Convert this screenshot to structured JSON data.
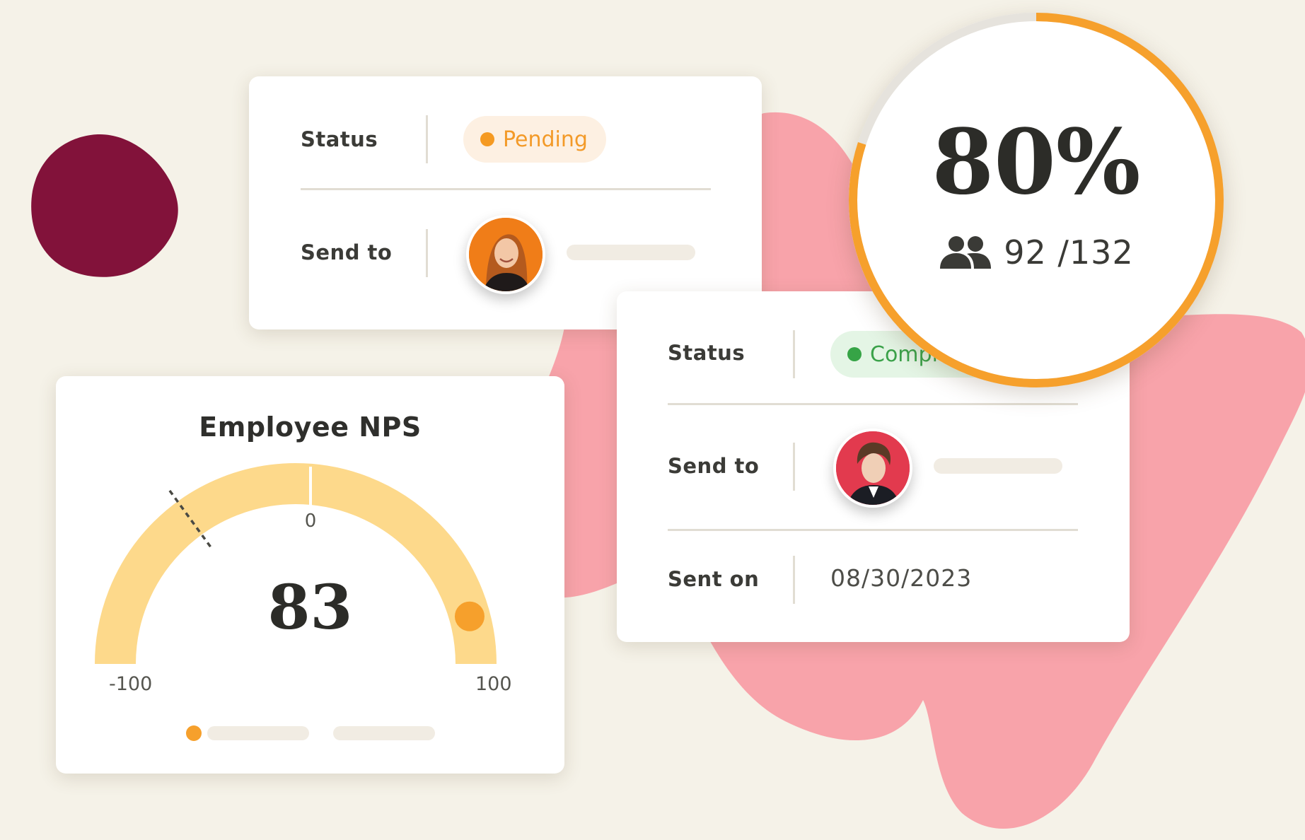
{
  "colors": {
    "background": "#f5f2e8",
    "blob_pink": "#f8a3aa",
    "blob_maroon": "#82123a",
    "accent_orange": "#f6a02c",
    "gauge_fill": "#fdd98b",
    "pending": "#f39a28",
    "complete": "#3ba24a"
  },
  "card_pending": {
    "status_label": "Status",
    "status_value": "Pending",
    "send_to_label": "Send to",
    "avatar_icon": "person-avatar-woman"
  },
  "card_complete": {
    "status_label": "Status",
    "status_value": "Completed",
    "send_to_label": "Send to",
    "avatar_icon": "person-avatar-man",
    "sent_on_label": "Sent on",
    "sent_on_value": "08/30/2023"
  },
  "response_rate": {
    "percent_label": "80%",
    "progress_fraction": 0.8,
    "people_icon": "people-icon",
    "count_label": "92 /132"
  },
  "nps": {
    "title": "Employee NPS",
    "score": "83",
    "score_value": 83,
    "benchmark_value": -40,
    "min_label": "-100",
    "mid_label": "0",
    "max_label": "100"
  }
}
